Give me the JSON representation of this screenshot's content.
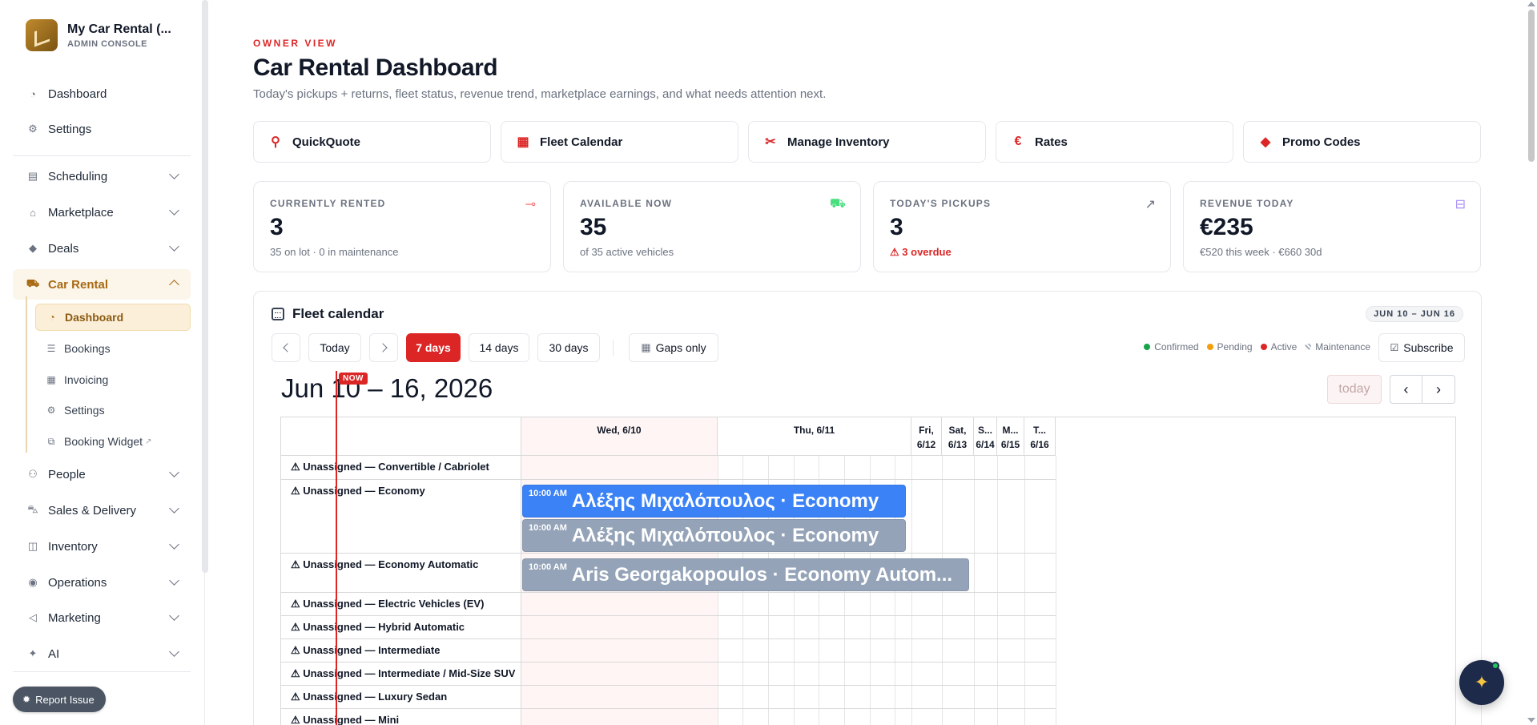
{
  "brand": {
    "title": "My Car Rental (...",
    "subtitle": "ADMIN CONSOLE"
  },
  "sidebar": {
    "top_items": [
      {
        "label": "Dashboard",
        "icon": "gauge-icon"
      },
      {
        "label": "Settings",
        "icon": "gear-icon"
      }
    ],
    "sections": [
      {
        "label": "Scheduling",
        "icon": "calendar-icon"
      },
      {
        "label": "Marketplace",
        "icon": "store-icon"
      },
      {
        "label": "Deals",
        "icon": "tag-icon"
      },
      {
        "label": "Car Rental",
        "icon": "car-icon",
        "expanded": true
      },
      {
        "label": "People",
        "icon": "people-icon"
      },
      {
        "label": "Sales & Delivery",
        "icon": "truck-icon"
      },
      {
        "label": "Inventory",
        "icon": "box-icon"
      },
      {
        "label": "Operations",
        "icon": "broadcast-icon"
      },
      {
        "label": "Marketing",
        "icon": "megaphone-icon"
      },
      {
        "label": "AI",
        "icon": "sparkle-icon"
      }
    ],
    "car_rental_items": [
      {
        "label": "Dashboard",
        "icon": "gauge-icon",
        "active": true
      },
      {
        "label": "Bookings",
        "icon": "list-icon"
      },
      {
        "label": "Invoicing",
        "icon": "document-icon"
      },
      {
        "label": "Settings",
        "icon": "gear-icon"
      },
      {
        "label": "Booking Widget",
        "icon": "external-link-icon",
        "external_mark": "↗"
      }
    ],
    "report_issue": "Report Issue"
  },
  "header": {
    "eyebrow": "OWNER VIEW",
    "title": "Car Rental Dashboard",
    "subtitle": "Today's pickups + returns, fleet status, revenue trend, marketplace earnings, and what needs attention next."
  },
  "quick_actions": [
    {
      "label": "QuickQuote",
      "icon": "search-icon"
    },
    {
      "label": "Fleet Calendar",
      "icon": "calendar-icon"
    },
    {
      "label": "Manage Inventory",
      "icon": "tools-icon"
    },
    {
      "label": "Rates",
      "icon": "euro-icon"
    },
    {
      "label": "Promo Codes",
      "icon": "tag-icon"
    }
  ],
  "stats": [
    {
      "label": "CURRENTLY RENTED",
      "value": "3",
      "sub": "35 on lot · 0 in maintenance",
      "icon": "key-icon",
      "icon_color": "#f87171"
    },
    {
      "label": "AVAILABLE NOW",
      "value": "35",
      "sub": "of 35 active vehicles",
      "icon": "car-icon",
      "icon_color": "#4ade80"
    },
    {
      "label": "TODAY'S PICKUPS",
      "value": "3",
      "sub": "3 overdue",
      "sub_warn": true,
      "icon": "arrow-up-right-icon",
      "icon_color": "#6b7280"
    },
    {
      "label": "REVENUE TODAY",
      "value": "€235",
      "sub": "€520 this week · €660 30d",
      "icon": "money-icon",
      "icon_color": "#a78bfa"
    }
  ],
  "fleet_calendar": {
    "title": "Fleet calendar",
    "range_badge": "JUN 10 – JUN 16",
    "toolbar": {
      "today": "Today",
      "views": [
        "7 days",
        "14 days",
        "30 days"
      ],
      "active_view": "7 days",
      "gaps_only": "Gaps only",
      "subscribe": "Subscribe"
    },
    "legend": [
      {
        "label": "Confirmed",
        "color": "#16a34a"
      },
      {
        "label": "Pending",
        "color": "#f59e0b"
      },
      {
        "label": "Active",
        "color": "#dc2626"
      },
      {
        "label": "Maintenance",
        "color": "#9ca3af"
      }
    ],
    "heading": "Jun 10 – 16, 2026",
    "today_button": "today",
    "now_tag": "NOW",
    "columns": [
      {
        "line1": "Wed, 6/10",
        "line2": "",
        "today": true
      },
      {
        "line1": "Thu, 6/11",
        "line2": ""
      },
      {
        "line1": "Fri,",
        "line2": "6/12"
      },
      {
        "line1": "Sat,",
        "line2": "6/13"
      },
      {
        "line1": "S...",
        "line2": "6/14"
      },
      {
        "line1": "M...",
        "line2": "6/15"
      },
      {
        "line1": "T...",
        "line2": "6/16"
      }
    ],
    "rows": [
      "⚠ Unassigned — Convertible / Cabriolet",
      "⚠ Unassigned — Economy",
      "⚠ Unassigned — Economy Automatic",
      "⚠ Unassigned — Electric Vehicles (EV)",
      "⚠ Unassigned — Hybrid Automatic",
      "⚠ Unassigned — Intermediate",
      "⚠ Unassigned — Intermediate / Mid-Size SUV",
      "⚠ Unassigned — Luxury Sedan",
      "⚠ Unassigned — Mini"
    ],
    "events": [
      {
        "time": "10:00 AM",
        "title": "Αλέξης Μιχαλόπουλος · Economy",
        "color": "#3b82f6"
      },
      {
        "time": "10:00 AM",
        "title": "Αλέξης Μιχαλόπουλος · Economy",
        "color": "#94a3b8"
      },
      {
        "time": "10:00 AM",
        "title": "Aris Georgakopoulos · Economy Autom...",
        "color": "#94a3b8"
      }
    ]
  }
}
